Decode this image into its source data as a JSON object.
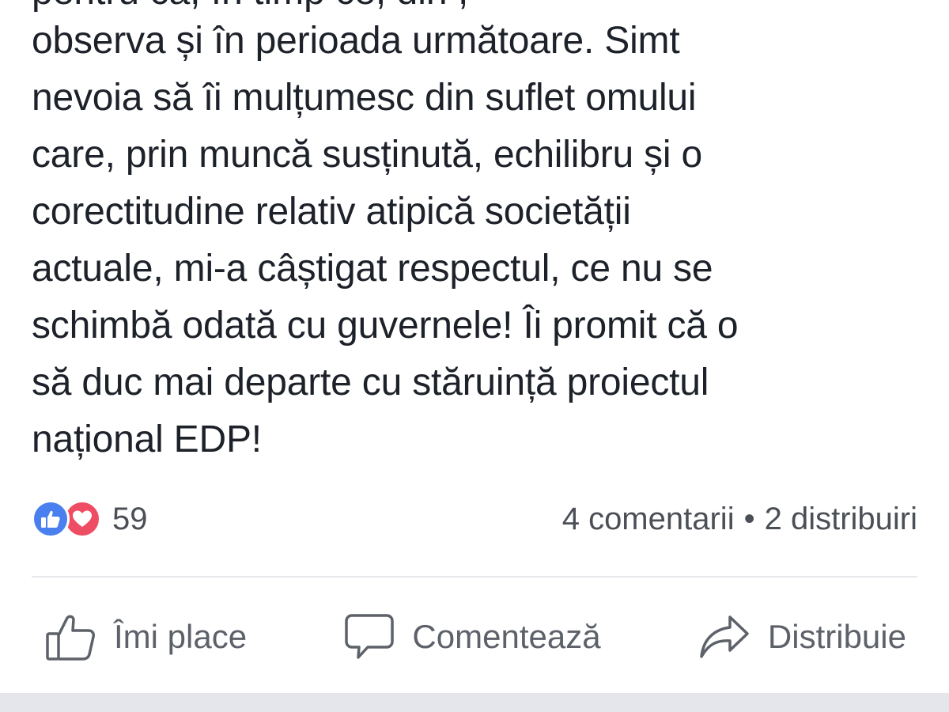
{
  "post": {
    "clipped_first_line": "pentru că, în timp ce, din ,",
    "lines": [
      "observa și în perioada următoare. Simt",
      "nevoia să îi mulțumesc din suflet omului",
      "care, prin muncă susținută, echilibru și o",
      "corectitudine relativ atipică societății",
      "actuale, mi-a câștigat respectul, ce nu se",
      "schimbă odată cu guvernele! Îi promit că o",
      "să duc mai departe cu stăruință proiectul",
      "național EDP!"
    ]
  },
  "stats": {
    "reactions": [
      "like-icon",
      "love-icon"
    ],
    "reaction_count": "59",
    "comments": "4 comentarii",
    "separator": "•",
    "shares": "2 distribuiri"
  },
  "actions": {
    "like_label": "Îmi place",
    "comment_label": "Comentează",
    "share_label": "Distribuie"
  },
  "colors": {
    "like_blue": "#4a7ff0",
    "love_red": "#ef4d63",
    "text": "#1d2129",
    "muted": "#5d6169",
    "divider": "#e6e8eb"
  }
}
